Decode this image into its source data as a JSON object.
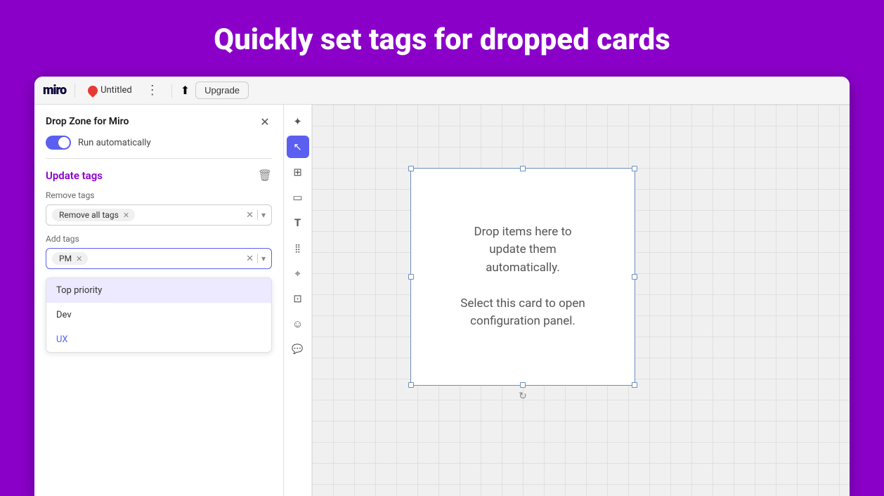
{
  "hero": {
    "title": "Quickly set tags for dropped cards"
  },
  "toolbar": {
    "logo": "miro",
    "title": "Untitled",
    "upgrade_label": "Upgrade"
  },
  "panel": {
    "title": "Drop Zone for Miro",
    "toggle_label": "Run automatically",
    "section_title": "Update tags",
    "remove_tags_label": "Remove tags",
    "remove_all_chip": "Remove all tags",
    "add_tags_label": "Add tags",
    "pm_chip": "PM"
  },
  "dropdown": {
    "items": [
      {
        "label": "Top priority",
        "highlighted": true
      },
      {
        "label": "Dev",
        "highlighted": false
      },
      {
        "label": "UX",
        "highlighted": false,
        "colored": true
      }
    ]
  },
  "card": {
    "line1": "Drop items here to",
    "line2": "update them",
    "line3": "automatically.",
    "line4": "",
    "line5": "Select this card to open",
    "line6": "configuration panel."
  },
  "sidebar_tools": [
    {
      "icon": "✦",
      "name": "move",
      "active": false
    },
    {
      "icon": "↖",
      "name": "select",
      "active": true
    },
    {
      "icon": "⊞",
      "name": "frame",
      "active": false
    },
    {
      "icon": "▭",
      "name": "shape",
      "active": false
    },
    {
      "icon": "T",
      "name": "text",
      "active": false
    },
    {
      "icon": "⣿",
      "name": "apps",
      "active": false
    },
    {
      "icon": "∧",
      "name": "more",
      "active": false
    },
    {
      "icon": "⊡",
      "name": "crop",
      "active": false
    },
    {
      "icon": "☺",
      "name": "emoji",
      "active": false
    },
    {
      "icon": "💬",
      "name": "comment",
      "active": false
    }
  ]
}
